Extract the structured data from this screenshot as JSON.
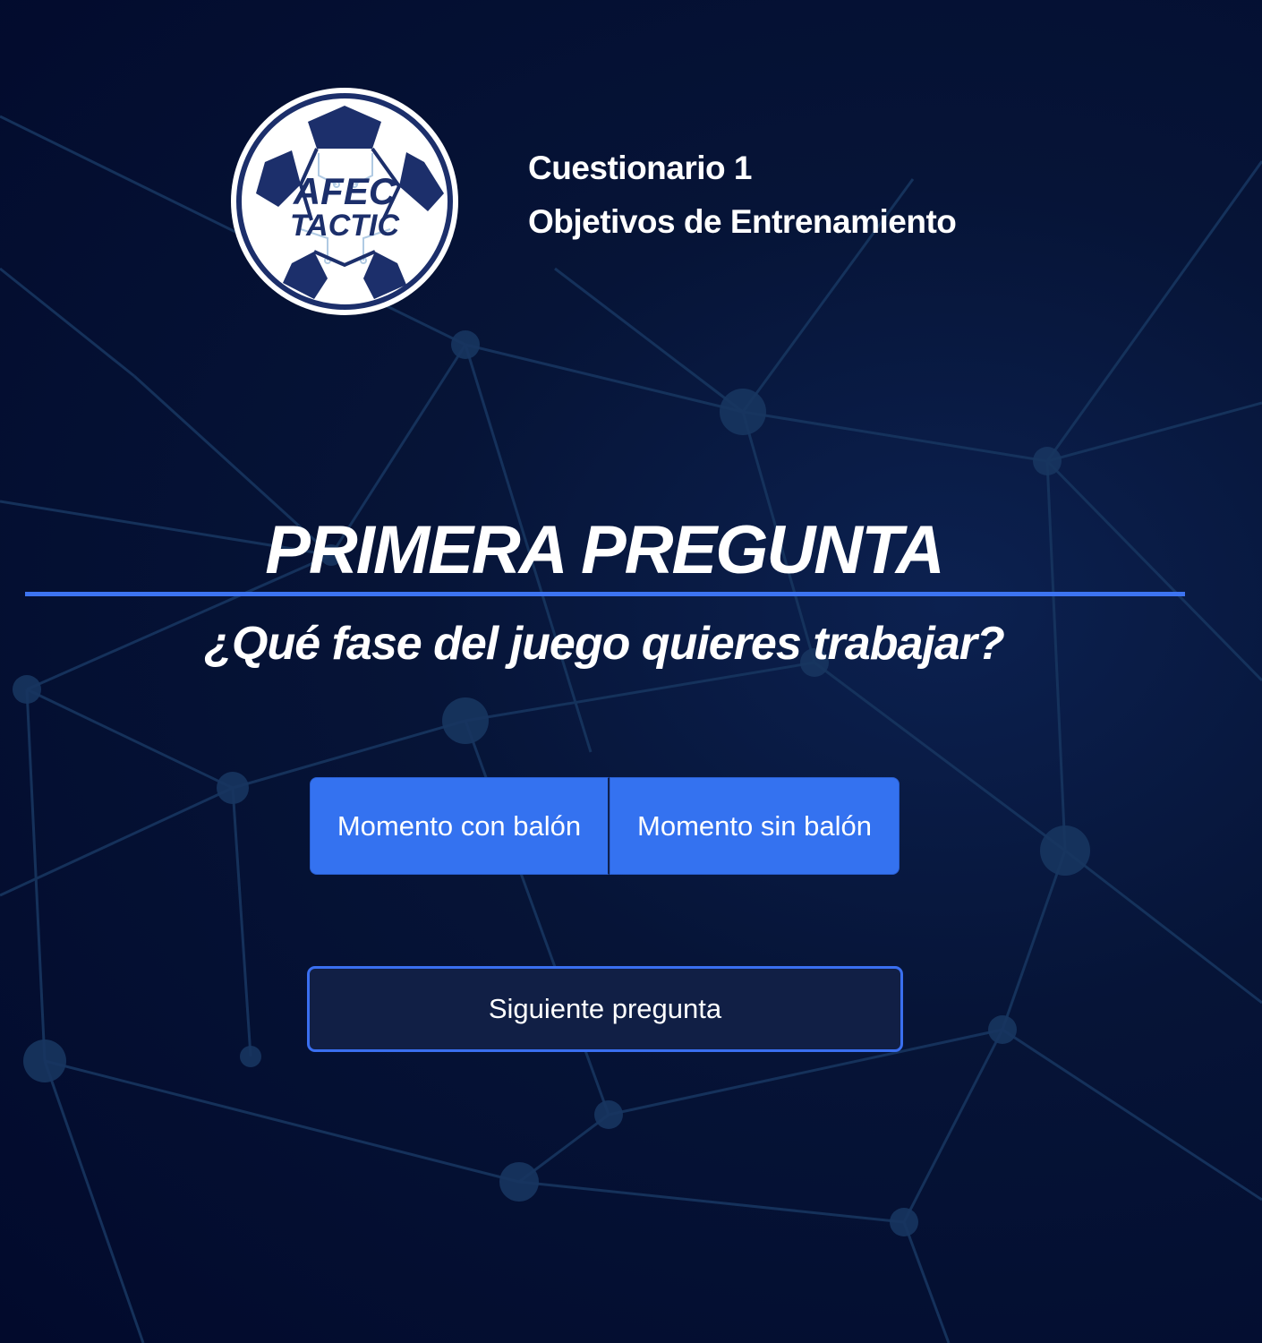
{
  "header": {
    "logo": {
      "icon": "soccer-ball-logo",
      "line1": "AFEC",
      "line2": "TACTIC"
    },
    "quiz_title": "Cuestionario 1",
    "quiz_subtitle": "Objetivos de Entrenamiento"
  },
  "question": {
    "title": "PRIMERA PREGUNTA",
    "text": "¿Qué fase del juego quieres trabajar?"
  },
  "options": [
    {
      "label": "Momento con balón"
    },
    {
      "label": "Momento sin balón"
    }
  ],
  "next_button": {
    "label": "Siguiente pregunta"
  },
  "colors": {
    "background": "#020a2c",
    "accent": "#3472f0",
    "network_lines": "#16325e",
    "next_button_bg": "#111f45"
  }
}
